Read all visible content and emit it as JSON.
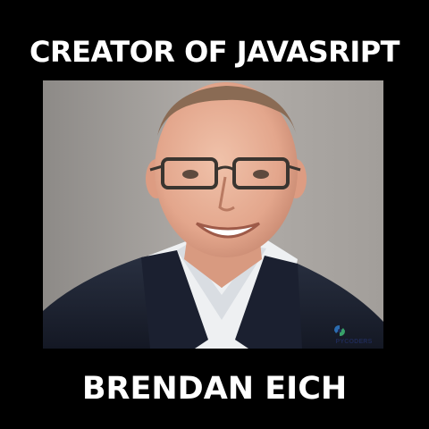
{
  "headline": "CREATOR OF JAVASRIPT",
  "name": "BRENDAN EICH",
  "watermark": {
    "text": "PYCODERS",
    "logo_icon": "pycoders-logo-icon"
  },
  "colors": {
    "background": "#000000",
    "text": "#ffffff",
    "photo_background": "#a6a29e",
    "jacket": "#1e2433",
    "shirt": "#eef0f2"
  }
}
